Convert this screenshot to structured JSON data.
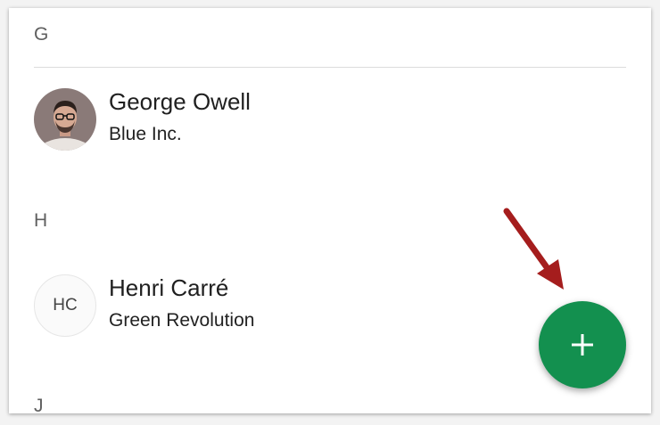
{
  "sections": [
    {
      "letter": "G",
      "contacts": [
        {
          "name": "George Owell",
          "company": "Blue Inc.",
          "avatar": "photo"
        }
      ]
    },
    {
      "letter": "H",
      "contacts": [
        {
          "name": "Henri Carré",
          "company": "Green Revolution",
          "avatar_initials": "HC"
        }
      ]
    },
    {
      "letter": "J",
      "contacts": []
    }
  ],
  "fab": {
    "icon": "plus-icon",
    "color": "#13904f"
  },
  "annotation": {
    "icon": "red-arrow-icon",
    "color": "#a51d1d"
  }
}
